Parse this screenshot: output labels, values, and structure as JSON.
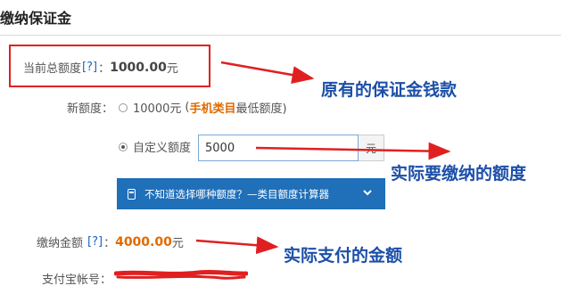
{
  "page": {
    "title": "缴纳保证金"
  },
  "current_total": {
    "label": "当前总额度",
    "help": "[?]",
    "colon": "：",
    "amount": "1000.00",
    "unit": "元"
  },
  "new_quota": {
    "label": "新额度：",
    "option_fixed": {
      "value_text": "10000元",
      "paren_open": "(",
      "category": "手机类目",
      "suffix": "最低额度)"
    },
    "option_custom": {
      "label": "自定义额度",
      "input_value": "5000",
      "unit": "元"
    }
  },
  "calculator_bar": {
    "label": "不知道选择哪种额度？—类目额度计算器"
  },
  "payment": {
    "label": "缴纳金额",
    "help": "[?]",
    "colon": "：",
    "amount": "4000.00",
    "unit": "元"
  },
  "alipay": {
    "label": "支付宝帐号："
  },
  "annotations": {
    "original_deposit": "原有的保证金钱款",
    "actual_quota": "实际要缴纳的额度",
    "actual_paid": "实际支付的金额"
  },
  "colors": {
    "accent_blue": "#1f6fb9",
    "annotation_red": "#e02020",
    "annotation_text": "#1c4fa8",
    "amount_orange": "#e06a00"
  }
}
